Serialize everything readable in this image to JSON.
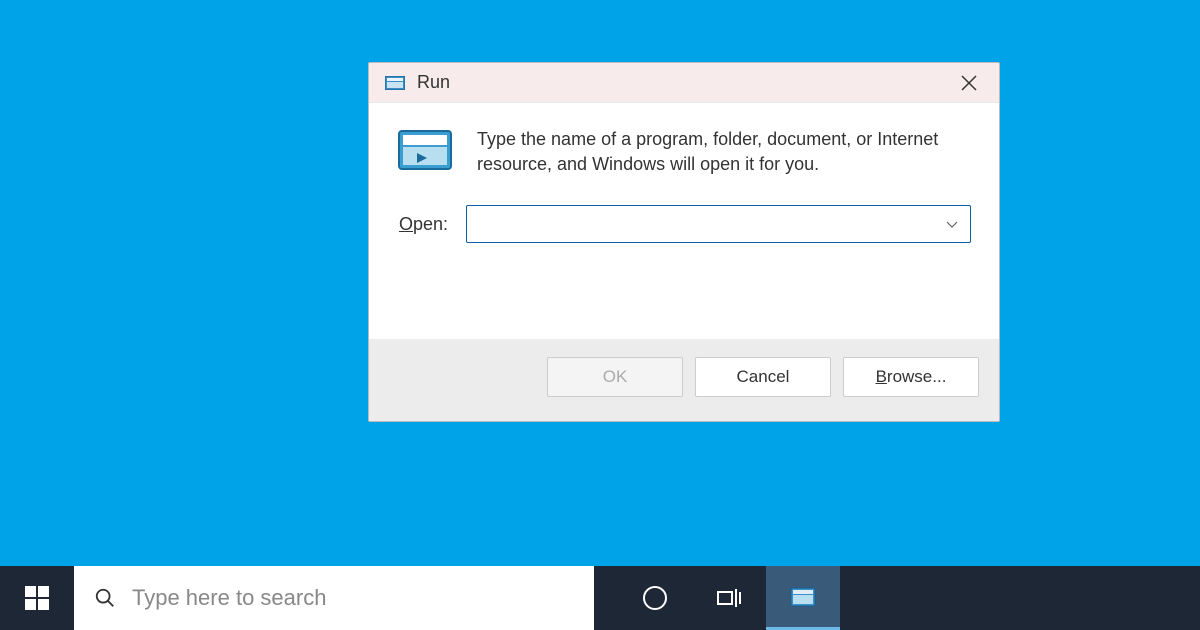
{
  "dialog": {
    "title": "Run",
    "description": "Type the name of a program, folder, document, or Internet resource, and Windows will open it for you.",
    "open_label_pre": "O",
    "open_label_rest": "pen:",
    "open_value": "",
    "ok_label": "OK",
    "cancel_label": "Cancel",
    "browse_label_pre": "B",
    "browse_label_rest": "rowse..."
  },
  "taskbar": {
    "search_placeholder": "Type here to search"
  }
}
